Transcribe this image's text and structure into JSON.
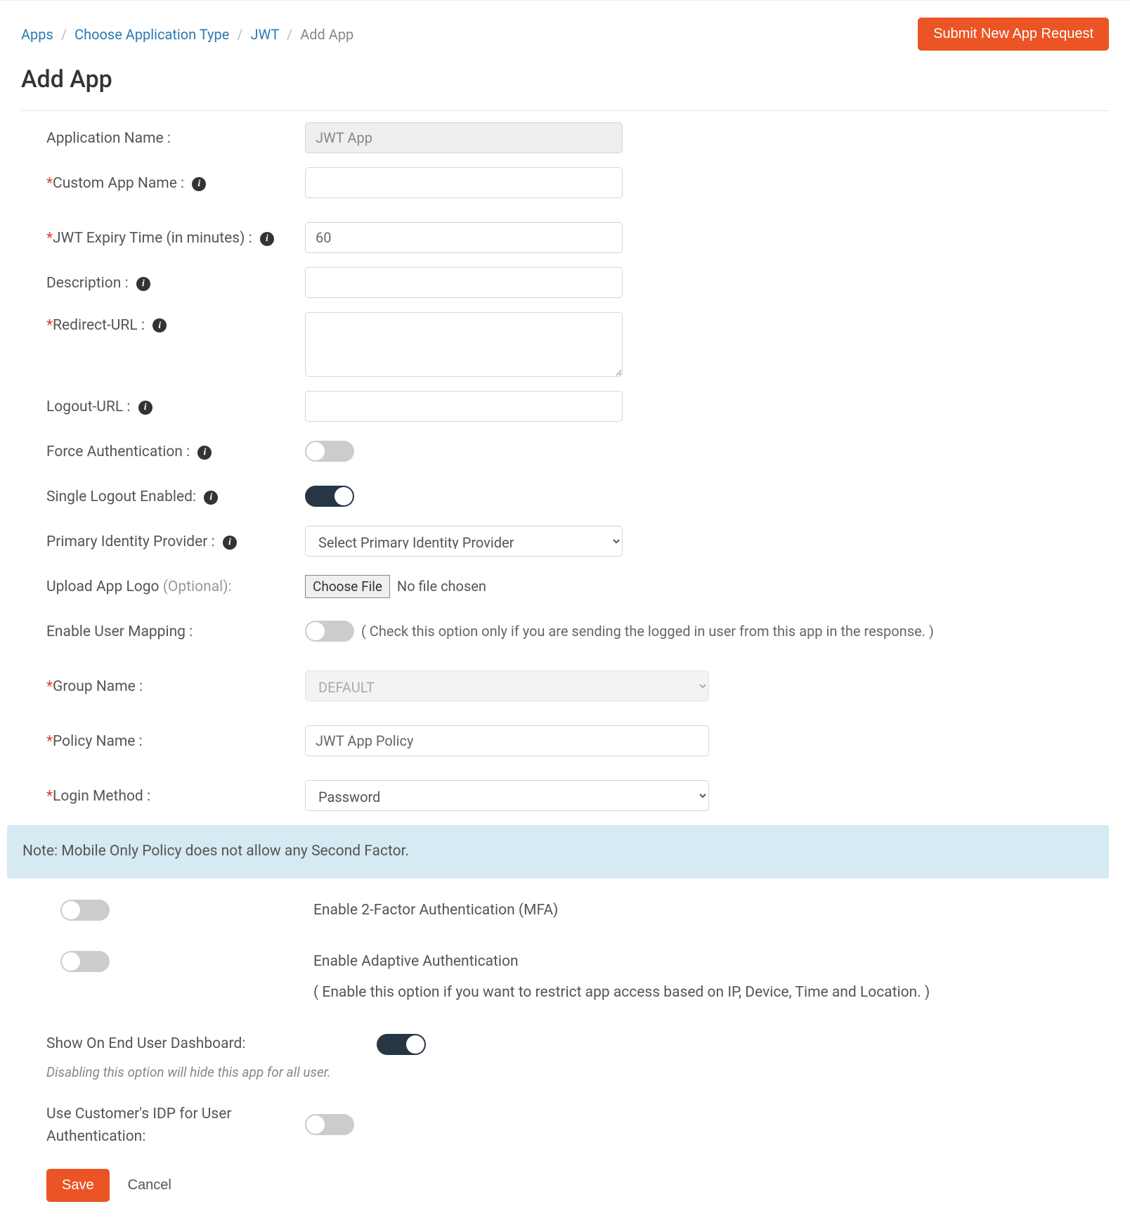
{
  "breadcrumb": {
    "items": [
      "Apps",
      "Choose Application Type",
      "JWT"
    ],
    "current": "Add App"
  },
  "header": {
    "submit_label": "Submit New App Request",
    "title": "Add App"
  },
  "form": {
    "application_name": {
      "label": "Application Name :",
      "value": "JWT App"
    },
    "custom_app_name": {
      "label": "Custom App Name :",
      "value": ""
    },
    "jwt_expiry": {
      "label": "JWT Expiry Time (in minutes) :",
      "value": "60"
    },
    "description": {
      "label": "Description :",
      "value": ""
    },
    "redirect_url": {
      "label": "Redirect-URL :",
      "value": ""
    },
    "logout_url": {
      "label": "Logout-URL :",
      "value": ""
    },
    "force_auth": {
      "label": "Force Authentication :",
      "on": false
    },
    "single_logout": {
      "label": "Single Logout Enabled:",
      "on": true
    },
    "primary_idp": {
      "label": "Primary Identity Provider :",
      "placeholder": "Select Primary Identity Provider"
    },
    "upload_logo": {
      "label": "Upload App Logo ",
      "optional": "(Optional):",
      "button": "Choose File",
      "status": "No file chosen"
    },
    "enable_user_mapping": {
      "label": "Enable User Mapping :",
      "on": false,
      "hint": "( Check this option only if you are sending the logged in user from this app in the response. )"
    },
    "group_name": {
      "label": "Group Name :",
      "value": "DEFAULT"
    },
    "policy_name": {
      "label": "Policy Name :",
      "value": "JWT App Policy"
    },
    "login_method": {
      "label": "Login Method :",
      "value": "Password"
    }
  },
  "note": "Note: Mobile Only Policy does not allow any Second Factor.",
  "extras": {
    "mfa": {
      "label": "Enable 2-Factor Authentication (MFA)",
      "on": false
    },
    "adaptive": {
      "label": "Enable Adaptive Authentication",
      "hint": "( Enable this option if you want to restrict app access based on IP, Device, Time and Location. )",
      "on": false
    },
    "show_dashboard": {
      "label": "Show On End User Dashboard:",
      "on": true,
      "hint": "Disabling this option will hide this app for all user."
    },
    "use_customer_idp": {
      "label": "Use Customer's IDP for User Authentication:",
      "on": false
    }
  },
  "actions": {
    "save": "Save",
    "cancel": "Cancel"
  },
  "icons": {
    "info": "i"
  }
}
